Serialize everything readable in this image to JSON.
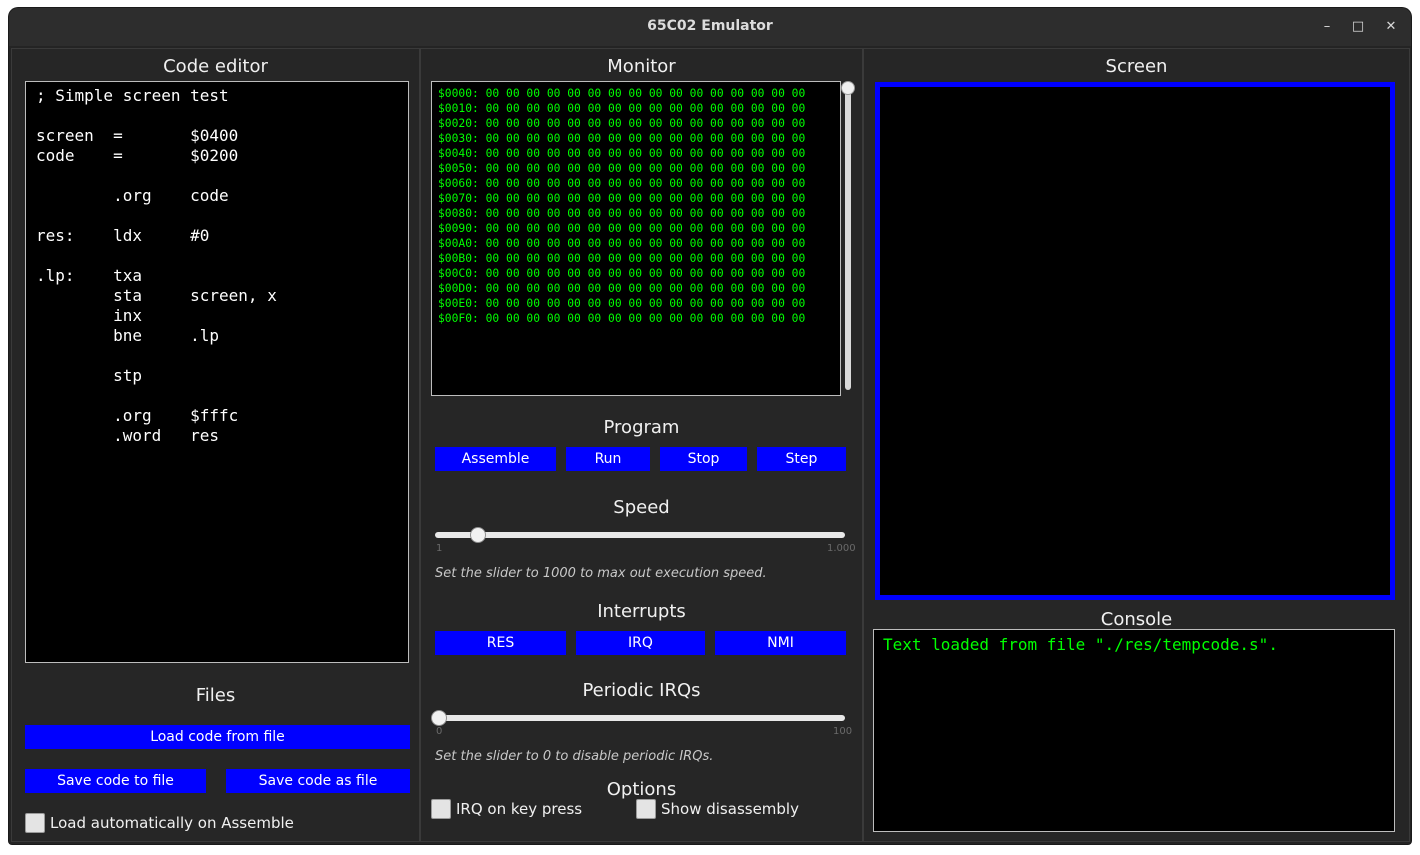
{
  "window": {
    "title": "65C02 Emulator",
    "minimize_icon": "minimize-icon",
    "maximize_icon": "maximize-icon",
    "close_icon": "close-icon"
  },
  "editor": {
    "title": "Code editor",
    "code": "; Simple screen test\n\nscreen  =       $0400\ncode    =       $0200\n\n        .org    code\n\nres:    ldx     #0\n\n.lp:    txa\n        sta     screen, x\n        inx\n        bne     .lp\n\n        stp\n\n        .org    $fffc\n        .word   res"
  },
  "files": {
    "title": "Files",
    "load_label": "Load code from file",
    "save_label": "Save code to file",
    "save_as_label": "Save code as file",
    "auto_load_label": "Load automatically on Assemble",
    "auto_load_checked": false
  },
  "monitor": {
    "title": "Monitor",
    "rows": [
      "$0000: 00 00 00 00 00 00 00 00 00 00 00 00 00 00 00 00",
      "$0010: 00 00 00 00 00 00 00 00 00 00 00 00 00 00 00 00",
      "$0020: 00 00 00 00 00 00 00 00 00 00 00 00 00 00 00 00",
      "$0030: 00 00 00 00 00 00 00 00 00 00 00 00 00 00 00 00",
      "$0040: 00 00 00 00 00 00 00 00 00 00 00 00 00 00 00 00",
      "$0050: 00 00 00 00 00 00 00 00 00 00 00 00 00 00 00 00",
      "$0060: 00 00 00 00 00 00 00 00 00 00 00 00 00 00 00 00",
      "$0070: 00 00 00 00 00 00 00 00 00 00 00 00 00 00 00 00",
      "$0080: 00 00 00 00 00 00 00 00 00 00 00 00 00 00 00 00",
      "$0090: 00 00 00 00 00 00 00 00 00 00 00 00 00 00 00 00",
      "$00A0: 00 00 00 00 00 00 00 00 00 00 00 00 00 00 00 00",
      "$00B0: 00 00 00 00 00 00 00 00 00 00 00 00 00 00 00 00",
      "$00C0: 00 00 00 00 00 00 00 00 00 00 00 00 00 00 00 00",
      "$00D0: 00 00 00 00 00 00 00 00 00 00 00 00 00 00 00 00",
      "$00E0: 00 00 00 00 00 00 00 00 00 00 00 00 00 00 00 00",
      "$00F0: 00 00 00 00 00 00 00 00 00 00 00 00 00 00 00 00"
    ]
  },
  "program": {
    "title": "Program",
    "assemble": "Assemble",
    "run": "Run",
    "stop": "Stop",
    "step": "Step"
  },
  "speed": {
    "title": "Speed",
    "min_label": "1",
    "max_label": "1.000",
    "value": 100,
    "min": 1,
    "max": 1000,
    "hint": "Set the slider to 1000 to max out execution speed."
  },
  "interrupts": {
    "title": "Interrupts",
    "res": "RES",
    "irq": "IRQ",
    "nmi": "NMI"
  },
  "periodic": {
    "title": "Periodic IRQs",
    "min_label": "0",
    "max_label": "100",
    "value": 0,
    "hint": "Set the slider to 0 to disable periodic IRQs."
  },
  "options": {
    "title": "Options",
    "irq_key_label": "IRQ on key press",
    "irq_key_checked": false,
    "disasm_label": "Show disassembly",
    "disasm_checked": false
  },
  "screen": {
    "title": "Screen",
    "border_color": "#0000ff"
  },
  "console": {
    "title": "Console",
    "text": "Text loaded from file \"./res/tempcode.s\"."
  },
  "colors": {
    "accent": "#0000ff",
    "text_green": "#00ff00"
  }
}
